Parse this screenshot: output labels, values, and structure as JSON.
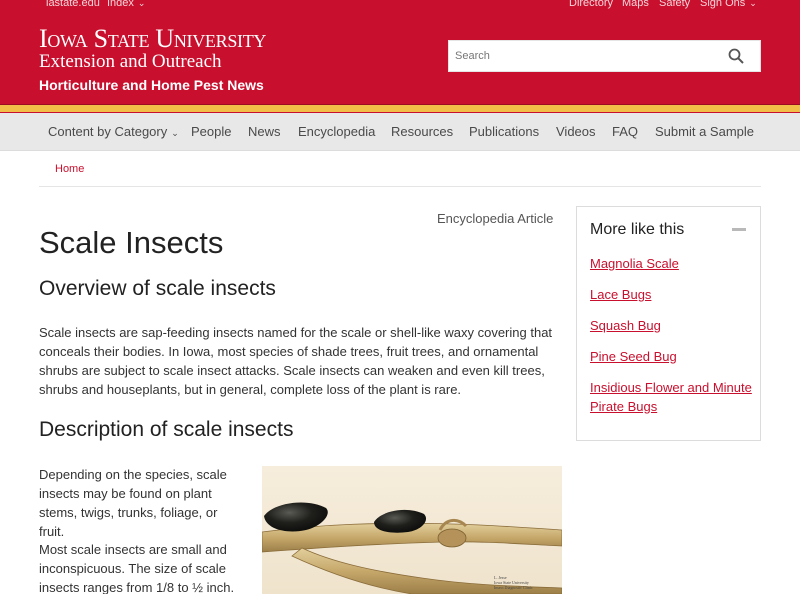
{
  "utility_bar": {
    "left_links": [
      "iastate.edu",
      "Index"
    ],
    "right_links": [
      "Directory",
      "Maps",
      "Safety",
      "Sign Ons"
    ]
  },
  "header": {
    "wordmark_line1": "Iowa State University",
    "wordmark_line2": "Extension and Outreach",
    "site_name": "Horticulture and Home Pest News",
    "search_placeholder": "Search"
  },
  "nav": {
    "items": [
      "Content by Category",
      "People",
      "News",
      "Encyclopedia",
      "Resources",
      "Publications",
      "Videos",
      "FAQ",
      "Submit a Sample"
    ]
  },
  "breadcrumb": {
    "home": "Home"
  },
  "article": {
    "type_label": "Encyclopedia Article",
    "title": "Scale Insects",
    "sections": [
      {
        "heading": "Overview of scale insects",
        "paragraphs": [
          "Scale insects are sap-feeding insects named for the scale or shell-like waxy covering that conceals their bodies. In Iowa, most species of shade trees, fruit trees, and ornamental shrubs are subject to scale insect attacks.  Scale insects can weaken and even kill trees, shrubs and houseplants, but in general, complete loss of the plant is rare."
        ]
      },
      {
        "heading": "Description of scale insects",
        "paragraphs": [
          "Depending on the species, scale insects may be found on plant stems, twigs, trunks, foliage, or fruit.",
          "Most scale insects are small and inconspicuous.  The size of scale insects ranges from 1/8 to ½ inch."
        ]
      }
    ],
    "photo_credit": [
      "L. Jesse",
      "Iowa State University",
      "Insect Diagnostic Clinic"
    ]
  },
  "sidebar": {
    "title": "More like this",
    "links": [
      "Magnolia Scale",
      "Lace Bugs",
      "Squash Bug",
      "Pine Seed Bug",
      "Insidious Flower and Minute Pirate Bugs"
    ]
  },
  "colors": {
    "brand_red": "#c8102e",
    "gold": "#f1be48",
    "nav_bg": "#e8e8e8"
  }
}
